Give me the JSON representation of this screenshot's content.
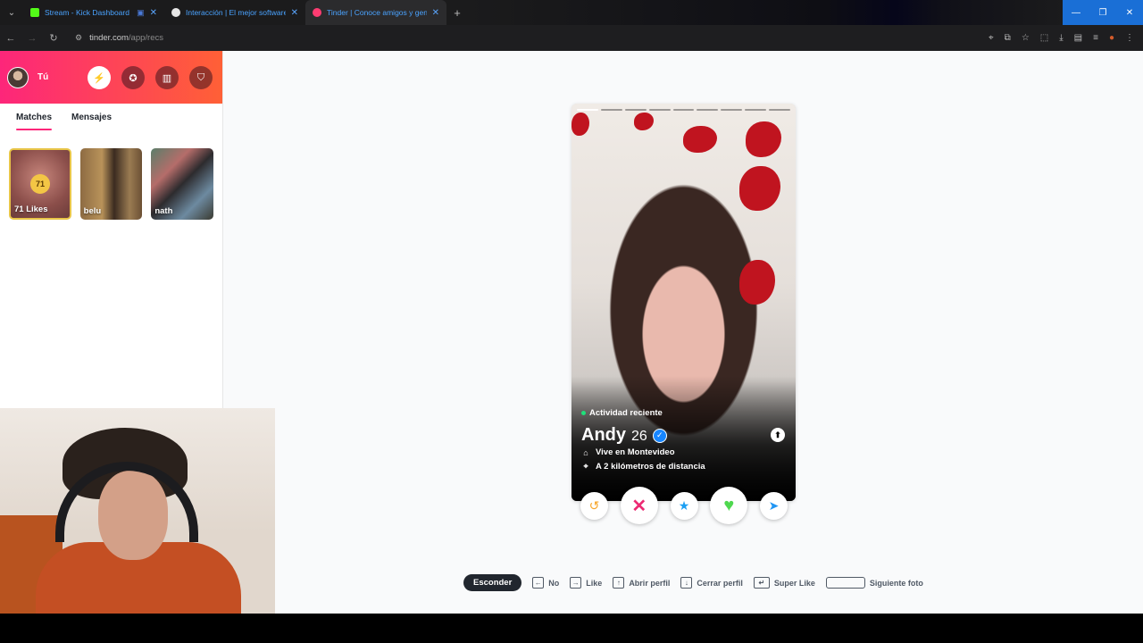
{
  "browser": {
    "tabs": [
      {
        "title": "Stream - Kick Dashboard",
        "favicon_color": "#53fc18",
        "active": false
      },
      {
        "title": "Interacción | El mejor software",
        "favicon_color": "#ffffff",
        "active": false
      },
      {
        "title": "Tinder | Conoce amigos y gent",
        "favicon_color": "#fe3c72",
        "active": true
      }
    ],
    "url_host": "tinder.com",
    "url_path": "/app/recs"
  },
  "sidebar": {
    "user_label": "Tú",
    "tabs": [
      "Matches",
      "Mensajes"
    ],
    "likes_count": "71",
    "likes_label": "71 Likes",
    "matches": [
      {
        "name": "belu"
      },
      {
        "name": "nath"
      }
    ]
  },
  "profile": {
    "activity": "Actividad reciente",
    "name": "Andy",
    "age": "26",
    "lives_in": "Vive en Montevideo",
    "distance": "A 2 kilómetros de distancia",
    "photo_count": 9,
    "current_photo": 1
  },
  "shortcuts": {
    "hide": "Esconder",
    "items": [
      "No",
      "Like",
      "Abrir perfil",
      "Cerrar perfil",
      "Super Like",
      "Siguiente foto"
    ]
  },
  "colors": {
    "brand_start": "#fd267a",
    "brand_end": "#ff6036",
    "verified": "#1786ff"
  }
}
